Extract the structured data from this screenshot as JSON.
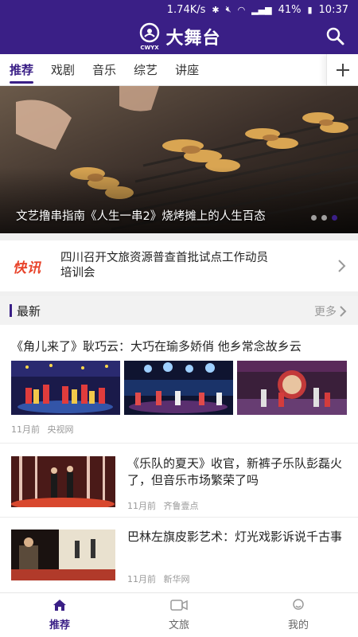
{
  "status_bar": {
    "speed": "1.74K/s",
    "battery": "41%",
    "time": "10:37"
  },
  "app": {
    "title": "大舞台",
    "logo_sub": "CWYX"
  },
  "tabs": [
    {
      "label": "推荐",
      "active": true
    },
    {
      "label": "戏剧",
      "active": false
    },
    {
      "label": "音乐",
      "active": false
    },
    {
      "label": "综艺",
      "active": false
    },
    {
      "label": "讲座",
      "active": false
    }
  ],
  "banner": {
    "caption": "文艺撸串指南《人生一串2》烧烤摊上的人生百态",
    "slide_count": 3,
    "active_slide": 3
  },
  "flash": {
    "badge": "快讯",
    "text": "四川召开文旅资源普查首批试点工作动员培训会"
  },
  "section": {
    "title": "最新",
    "more": "更多"
  },
  "articles": [
    {
      "title": "《角儿来了》耿巧云：大巧在瑜多娇俏 他乡常念故乡云",
      "time": "11月前",
      "source": "央视网"
    },
    {
      "title": "《乐队的夏天》收官，新裤子乐队彭磊火了，但音乐市场繁荣了吗",
      "time": "11月前",
      "source": "齐鲁壹点"
    },
    {
      "title": "巴林左旗皮影艺术：灯光戏影诉说千古事",
      "time": "11月前",
      "source": "新华网"
    }
  ],
  "bottom_nav": [
    {
      "label": "推荐",
      "icon": "home-icon",
      "active": true
    },
    {
      "label": "文旅",
      "icon": "video-icon",
      "active": false
    },
    {
      "label": "我的",
      "icon": "profile-icon",
      "active": false
    }
  ],
  "colors": {
    "brand": "#3a1f86",
    "flash_red": "#e8432a"
  }
}
